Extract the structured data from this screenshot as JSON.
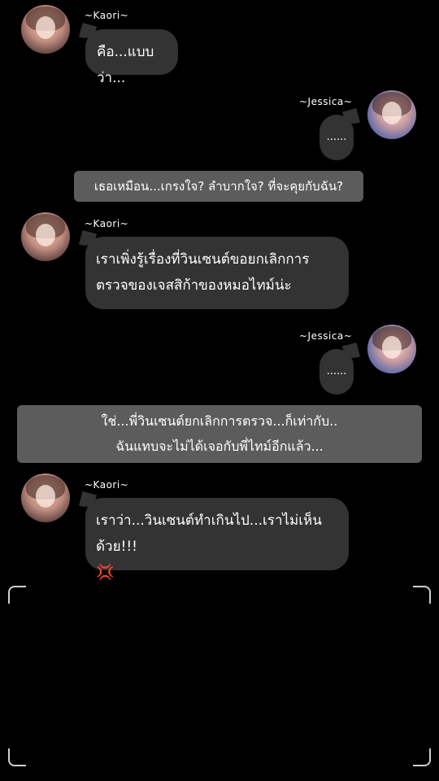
{
  "chat": {
    "names": {
      "kaori": "~Kaori~",
      "jessica": "~Jessica~"
    },
    "m1": {
      "text": "คือ...แบบว่า..."
    },
    "m2": {
      "text": "......"
    },
    "n1": {
      "text": "เธอเหมือน...เกรงใจ? ลำบากใจ? ที่จะคุยกับฉัน?"
    },
    "m3": {
      "line1": "เราเพิ่งรู้เรื่องที่วินเซนต์ขอยกเลิกการ",
      "line2": "ตรวจของเจสสิก้าของหมอไทม์น่ะ"
    },
    "m4": {
      "text": "......"
    },
    "n2": {
      "line1": "ใช่...พี่วินเซนต์ยกเลิกการตรวจ...ก็เท่ากับ..",
      "line2": "ฉันแทบจะไม่ได้เจอกับพี่ไทม์อีกแล้ว..."
    },
    "m5": {
      "line1": "เราว่า...วินเซนต์ทำเกินไป...เราไม่เห็นด้วย!!!",
      "emoji": "💢",
      "emoji_icon": "anger-symbol-icon"
    }
  },
  "colors": {
    "background": "#000000",
    "bubble": "#333333",
    "narration": "#5c5c5c"
  }
}
